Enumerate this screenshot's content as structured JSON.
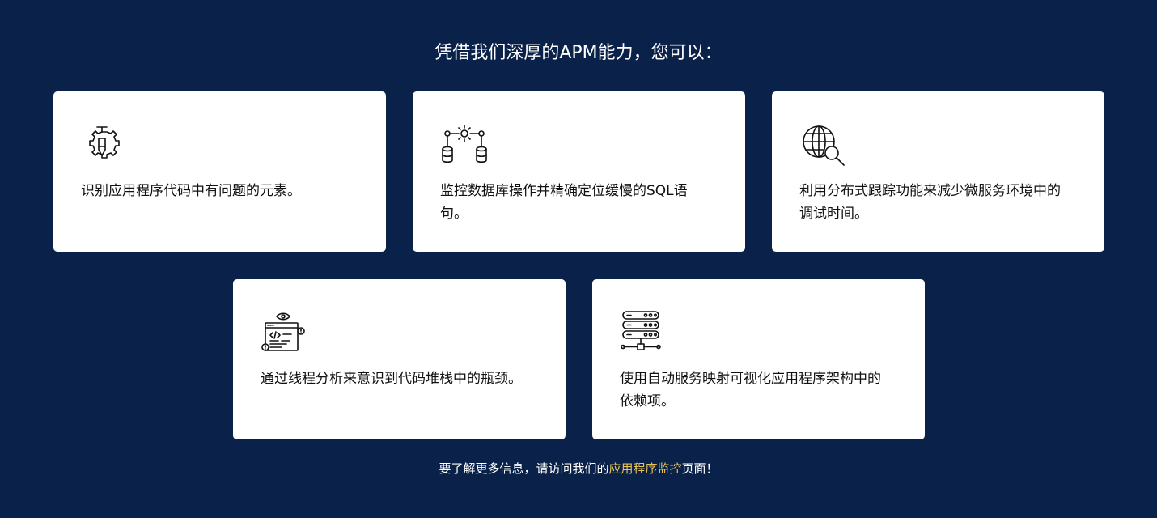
{
  "heading": "凭借我们深厚的APM能力，您可以：",
  "cards": [
    {
      "icon": "gear-pencil-icon",
      "text": "识别应用程序代码中有问题的元素。"
    },
    {
      "icon": "database-gear-icon",
      "text": "监控数据库操作并精确定位缓慢的SQL语句。"
    },
    {
      "icon": "globe-search-icon",
      "text": "利用分布式跟踪功能来减少微服务环境中的调试时间。"
    },
    {
      "icon": "code-window-icon",
      "text": "通过线程分析来意识到代码堆栈中的瓶颈。"
    },
    {
      "icon": "server-network-icon",
      "text": "使用自动服务映射可视化应用程序架构中的依赖项。"
    }
  ],
  "footer": {
    "prefix": "要了解更多信息，请访问我们的",
    "link_text": "应用程序监控",
    "suffix": "页面！"
  },
  "colors": {
    "background": "#0a2249",
    "card": "#ffffff",
    "link": "#e7c35a"
  }
}
